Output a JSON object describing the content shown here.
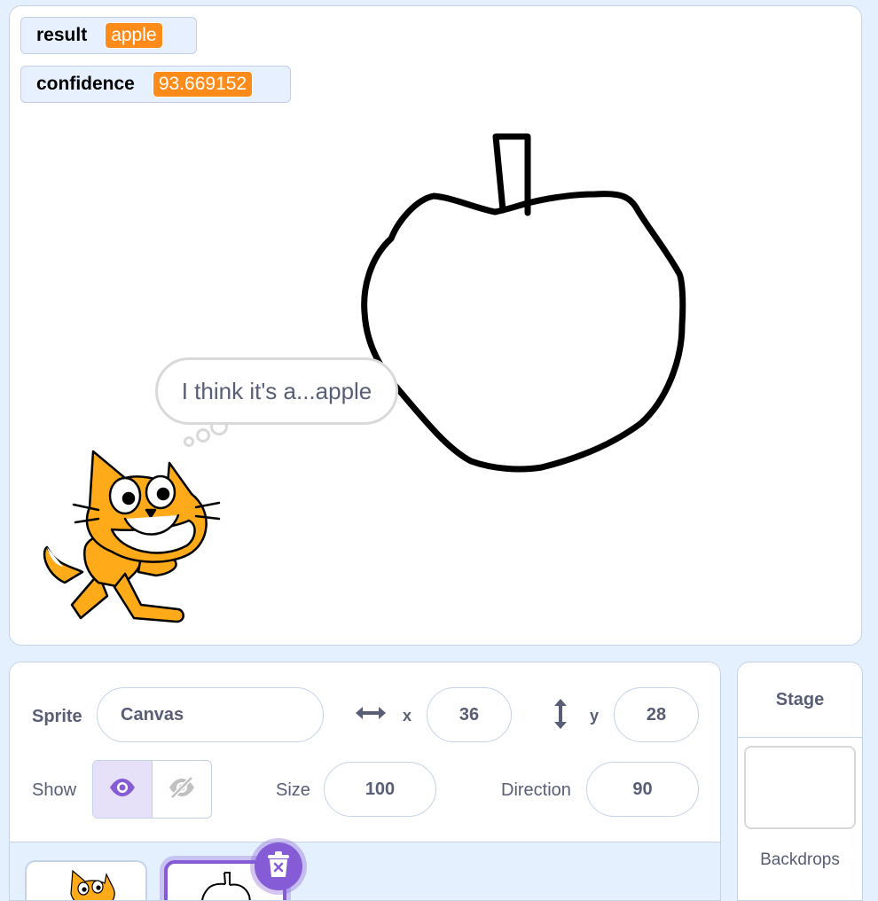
{
  "stage": {
    "monitors": [
      {
        "label": "result",
        "value": "apple"
      },
      {
        "label": "confidence",
        "value": "93.669152"
      }
    ],
    "speech_bubble": "I think it's a...apple"
  },
  "sprite_info": {
    "sprite_label": "Sprite",
    "sprite_name": "Canvas",
    "x_label": "x",
    "x_value": "36",
    "y_label": "y",
    "y_value": "28",
    "show_label": "Show",
    "size_label": "Size",
    "size_value": "100",
    "direction_label": "Direction",
    "direction_value": "90"
  },
  "stage_selector": {
    "title": "Stage",
    "backdrops_label": "Backdrops"
  },
  "colors": {
    "accent": "#855cd6",
    "monitor_value": "#ff8c1a",
    "background": "#e5f0ff"
  }
}
